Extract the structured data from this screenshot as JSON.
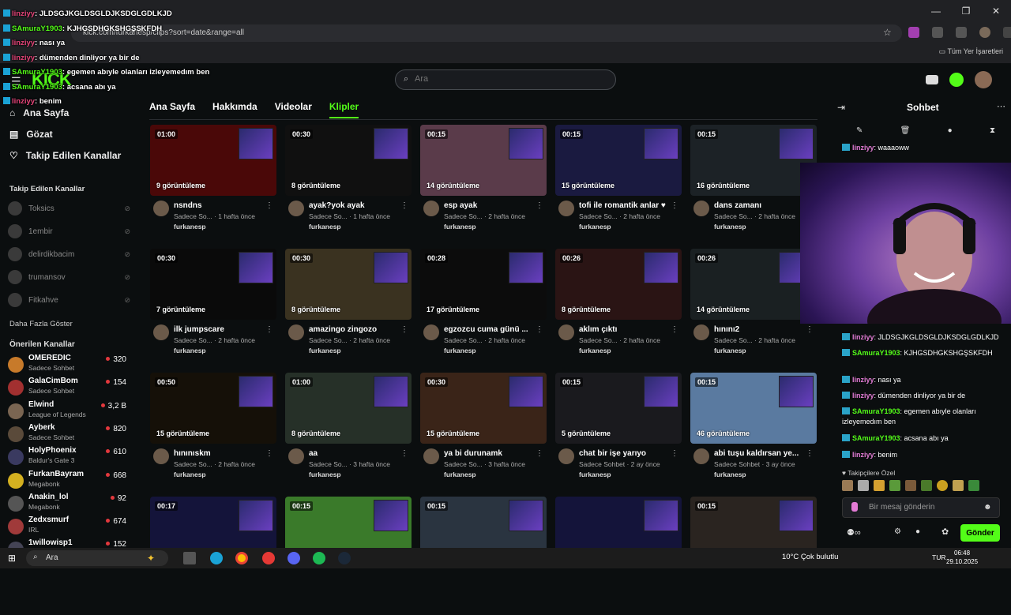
{
  "browser": {
    "url": "kick.com/furkanesp/clips?sort=date&range=all",
    "bookmarks_label": "Tüm Yer İşaretleri",
    "window_controls": [
      "—",
      "❐",
      "✕"
    ]
  },
  "header": {
    "logo": "KICK",
    "search_placeholder": "Ara"
  },
  "sidebar": {
    "nav": [
      {
        "label": "Ana Sayfa",
        "icon": "home-icon"
      },
      {
        "label": "Gözat",
        "icon": "browse-icon"
      },
      {
        "label": "Takip Edilen Kanallar",
        "icon": "heart-icon"
      }
    ],
    "followed_title": "Takip Edilen Kanallar",
    "followed": [
      "Toksics",
      "1embir",
      "delirdikbacim",
      "trumansov",
      "Fitkahve"
    ],
    "show_more": "Daha Fazla Göster",
    "recommended_title": "Önerilen Kanallar",
    "recommended": [
      {
        "name": "OMEREDIC",
        "category": "Sadece Sohbet",
        "viewers": "320",
        "color": "#c77a2a"
      },
      {
        "name": "GalaCimBom",
        "category": "Sadece Sohbet",
        "viewers": "154",
        "color": "#a23030"
      },
      {
        "name": "Elwind",
        "category": "League of Legends",
        "viewers": "3,2 B",
        "color": "#7a6552"
      },
      {
        "name": "Ayberk",
        "category": "Sadece Sohbet",
        "viewers": "820",
        "color": "#5a4a3a"
      },
      {
        "name": "HolyPhoenix",
        "category": "Baldur's Gate 3",
        "viewers": "610",
        "color": "#3a3a60"
      },
      {
        "name": "FurkanBayram",
        "category": "Megabonk",
        "viewers": "668",
        "color": "#d4b020"
      },
      {
        "name": "Anakin_lol",
        "category": "Megabonk",
        "viewers": "92",
        "color": "#555"
      },
      {
        "name": "Zedxsmurf",
        "category": "IRL",
        "viewers": "674",
        "color": "#a03a3a"
      },
      {
        "name": "1willowisp1",
        "category": "",
        "viewers": "152",
        "color": "#445"
      }
    ]
  },
  "tabs": [
    "Ana Sayfa",
    "Hakkımda",
    "Videolar",
    "Klipler"
  ],
  "clips": [
    {
      "dur": "01:00",
      "views": "9 görüntüleme",
      "title": "nsndns",
      "meta": "Sadece So... · 1 hafta önce",
      "user": "furkanesp",
      "bg": "#4a0808"
    },
    {
      "dur": "00:30",
      "views": "8 görüntüleme",
      "title": "ayak?yok ayak",
      "meta": "Sadece So... · 1 hafta önce",
      "user": "furkanesp",
      "bg": "#101010"
    },
    {
      "dur": "00:15",
      "views": "14 görüntüleme",
      "title": "esp ayak",
      "meta": "Sadece So... · 2 hafta önce",
      "user": "furkanesp",
      "bg": "#5a3b4a"
    },
    {
      "dur": "00:15",
      "views": "15 görüntüleme",
      "title": "tofi ile romantik anlar ♥",
      "meta": "Sadece So... · 2 hafta önce",
      "user": "furkanesp",
      "bg": "#1a1a40"
    },
    {
      "dur": "00:15",
      "views": "16 görüntüleme",
      "title": "dans zamanı",
      "meta": "Sadece So... · 2 hafta önce",
      "user": "furkanesp",
      "bg": "#1c2226"
    },
    {
      "dur": "00:30",
      "views": "7 görüntüleme",
      "title": "ilk jumpscare",
      "meta": "Sadece So... · 2 hafta önce",
      "user": "furkanesp",
      "bg": "#0a0a0a"
    },
    {
      "dur": "00:30",
      "views": "8 görüntüleme",
      "title": "amazingo zingozo",
      "meta": "Sadece So... · 2 hafta önce",
      "user": "furkanesp",
      "bg": "#3a3220"
    },
    {
      "dur": "00:28",
      "views": "17 görüntüleme",
      "title": "egzozcu cuma günü ...",
      "meta": "Sadece So... · 2 hafta önce",
      "user": "furkanesp",
      "bg": "#0c0c0c"
    },
    {
      "dur": "00:26",
      "views": "8 görüntüleme",
      "title": "aklım çıktı",
      "meta": "Sadece So... · 2 hafta önce",
      "user": "furkanesp",
      "bg": "#2a1414"
    },
    {
      "dur": "00:26",
      "views": "14 görüntüleme",
      "title": "hınını2",
      "meta": "Sadece So... · 2 hafta önce",
      "user": "furkanesp",
      "bg": "#1a2022"
    },
    {
      "dur": "00:50",
      "views": "15 görüntüleme",
      "title": "hınınıskm",
      "meta": "Sadece So... · 2 hafta önce",
      "user": "furkanesp",
      "bg": "#151008"
    },
    {
      "dur": "01:00",
      "views": "8 görüntüleme",
      "title": "aa",
      "meta": "Sadece So... · 3 hafta önce",
      "user": "furkanesp",
      "bg": "#263028"
    },
    {
      "dur": "00:30",
      "views": "15 görüntüleme",
      "title": "ya bi durunamk",
      "meta": "Sadece So... · 3 hafta önce",
      "user": "furkanesp",
      "bg": "#3a2418"
    },
    {
      "dur": "00:15",
      "views": "5 görüntüleme",
      "title": "chat bir işe yarıyo",
      "meta": "Sadece Sohbet · 2 ay önce",
      "user": "furkanesp",
      "bg": "#1a1a1e"
    },
    {
      "dur": "00:15",
      "views": "46 görüntüleme",
      "title": "abi tuşu kaldırsan ye...",
      "meta": "Sadece Sohbet · 3 ay önce",
      "user": "furkanesp",
      "bg": "#5a7aa0"
    },
    {
      "dur": "00:17",
      "views": "",
      "title": "",
      "meta": "",
      "user": "",
      "bg": "#14143a"
    },
    {
      "dur": "00:15",
      "views": "",
      "title": "",
      "meta": "",
      "user": "",
      "bg": "#3a7a2a"
    },
    {
      "dur": "00:15",
      "views": "",
      "title": "",
      "meta": "",
      "user": "",
      "bg": "#2a3440"
    },
    {
      "dur": "",
      "views": "",
      "title": "",
      "meta": "",
      "user": "",
      "bg": "#14143a"
    },
    {
      "dur": "00:15",
      "views": "",
      "title": "",
      "meta": "",
      "user": "",
      "bg": "#2a2420"
    }
  ],
  "chat": {
    "title": "Sohbet",
    "lines": [
      {
        "user": "linziyy",
        "msg": ": waaaoww",
        "type": "u1"
      },
      {
        "user": "linziyy",
        "msg": ": JLDSGJKGLDSGLDJKSDGLGDLKJD",
        "type": "u1"
      },
      {
        "user": "SAmuraY1903",
        "msg": ": KJHGSDHGKSHGŞSKFDH",
        "type": "u2"
      },
      {
        "user": "linziyy",
        "msg": ": nası ya",
        "type": "u1"
      },
      {
        "user": "linziyy",
        "msg": ": dümenden dinliyor ya bir de",
        "type": "u1"
      },
      {
        "user": "SAmuraY1903",
        "msg": ": egemen abıyle olanları izleyemedım ben",
        "type": "u2"
      },
      {
        "user": "SAmuraY1903",
        "msg": ": acsana abı ya",
        "type": "u2"
      },
      {
        "user": "linziyy",
        "msg": ": benim",
        "type": "u1"
      }
    ],
    "followers_only": "Takipçilere Özel",
    "input_placeholder": "Bir mesaj gönderin",
    "send": "Gönder"
  },
  "overlay": [
    {
      "user": "linziyy",
      "msg": ": JLDSGJKGLDSGLDJKSDGLGDLKJD",
      "type": "p"
    },
    {
      "user": "SAmuraY1903",
      "msg": ": KJHGSDHGKSHGŞSKFDH",
      "type": "g"
    },
    {
      "user": "linziyy",
      "msg": ": nası ya",
      "type": "p"
    },
    {
      "user": "linziyy",
      "msg": ": dümenden dinliyor ya bir de",
      "type": "p"
    },
    {
      "user": "SAmuraY1903",
      "msg": ": egemen abıyle olanları izleyemedım ben",
      "type": "g"
    },
    {
      "user": "SAmuraY1903",
      "msg": ": acsana abı ya",
      "type": "g"
    },
    {
      "user": "linziyy",
      "msg": ": benim",
      "type": "p"
    }
  ],
  "taskbar": {
    "search": "Ara",
    "weather": "10°C  Çok bulutlu",
    "lang": "TUR",
    "time": "06:48",
    "date": "29.10.2025"
  }
}
